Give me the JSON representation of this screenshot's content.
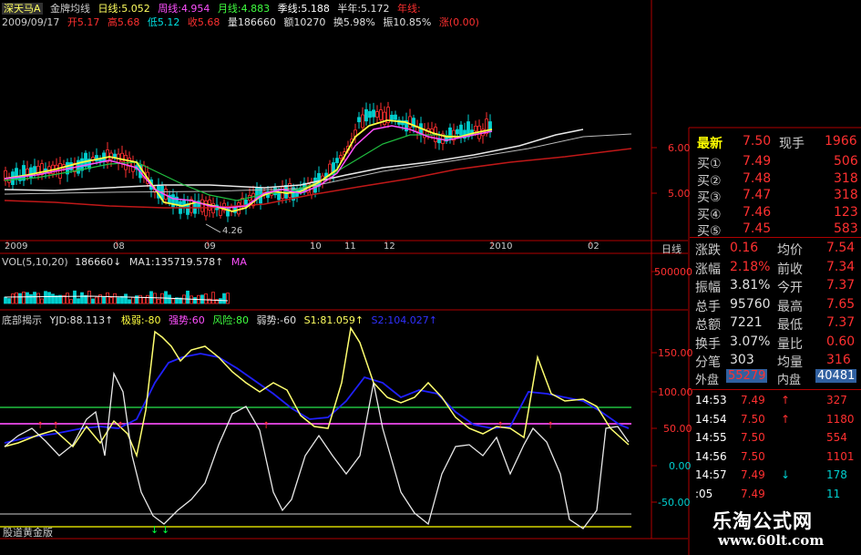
{
  "header": {
    "stock": "深天马A",
    "indicator": "金牌均线",
    "ma_day": "日线:5.052",
    "ma_week": "周线:4.954",
    "ma_month": "月线:4.883",
    "ma_season": "季线:5.188",
    "ma_half": "半年:5.172",
    "ma_year": "年线:",
    "date": "2009/09/17",
    "open": "开5.17",
    "high": "高5.68",
    "low": "低5.12",
    "close": "收5.68",
    "volume": "量186660",
    "amount": "额10270",
    "turnover": "换5.98%",
    "amplitude": "振10.85%",
    "change": "涨(0.00)"
  },
  "price_chart": {
    "y_labels": [
      "6.00",
      "5.00"
    ],
    "low_marker": "4.26",
    "x_labels": [
      "2009",
      "08",
      "09",
      "10",
      "11",
      "12",
      "2010",
      "02"
    ],
    "period_label": "日线"
  },
  "volume_chart": {
    "legend": "VOL(5,10,20)",
    "vol_value": "186660↓",
    "ma1": "MA1:135719.578↑",
    "ma2": "MA",
    "y_label": "500000"
  },
  "indicator_chart": {
    "name": "底部揭示",
    "yjd": "YJD:88.113↑",
    "jiruo": "极弱:-80",
    "qiangshi": "强势:60",
    "fengxian": "风险:80",
    "ruoshi": "弱势:-60",
    "s1": "S1:81.059↑",
    "s2": "S2:104.027↑",
    "y_labels": [
      "150.00",
      "100.00",
      "50.00",
      "0.00",
      "-50.00"
    ],
    "footer": "股道黄金版"
  },
  "quote": {
    "latest_label": "最新",
    "latest_value": "7.50",
    "xianshou_label": "现手",
    "xianshou_value": "1966",
    "buy": [
      {
        "label": "买①",
        "price": "7.49",
        "vol": "506"
      },
      {
        "label": "买②",
        "price": "7.48",
        "vol": "318"
      },
      {
        "label": "买③",
        "price": "7.47",
        "vol": "318"
      },
      {
        "label": "买④",
        "price": "7.46",
        "vol": "123"
      },
      {
        "label": "买⑤",
        "price": "7.45",
        "vol": "583"
      }
    ],
    "stats": [
      {
        "l1": "涨跌",
        "v1": "0.16",
        "l2": "均价",
        "v2": "7.54"
      },
      {
        "l1": "涨幅",
        "v1": "2.18%",
        "l2": "前收",
        "v2": "7.34"
      },
      {
        "l1": "振幅",
        "v1": "3.81%",
        "l2": "今开",
        "v2": "7.37"
      },
      {
        "l1": "总手",
        "v1": "95760",
        "l2": "最高",
        "v2": "7.65"
      },
      {
        "l1": "总额",
        "v1": "7221",
        "l2": "最低",
        "v2": "7.37"
      },
      {
        "l1": "换手",
        "v1": "3.07%",
        "l2": "量比",
        "v2": "0.60"
      },
      {
        "l1": "分笔",
        "v1": "303",
        "l2": "均量",
        "v2": "316"
      }
    ],
    "waipan_label": "外盘",
    "waipan_value": "55279",
    "neipan_label": "内盘",
    "neipan_value": "40481"
  },
  "ticks": [
    {
      "time": "14:53",
      "price": "7.49",
      "arrow": "↑",
      "vol": "327"
    },
    {
      "time": "14:54",
      "price": "7.50",
      "arrow": "↑",
      "vol": "1180"
    },
    {
      "time": "14:55",
      "price": "7.50",
      "arrow": "",
      "vol": "554"
    },
    {
      "time": "14:56",
      "price": "7.50",
      "arrow": "",
      "vol": "1101"
    },
    {
      "time": "14:57",
      "price": "7.49",
      "arrow": "↓",
      "vol": "178"
    },
    {
      "time": ":05",
      "price": "7.49",
      "arrow": "",
      "vol": "11"
    }
  ],
  "watermark": {
    "title": "乐淘公式网",
    "url": "www.60lt.com"
  },
  "colors": {
    "up": "#ff3030",
    "down": "#00d0d0",
    "yellow": "#ffff00",
    "white": "#ffffff",
    "magenta": "#ff40ff",
    "green": "#00ff40",
    "grid": "#b00000"
  }
}
